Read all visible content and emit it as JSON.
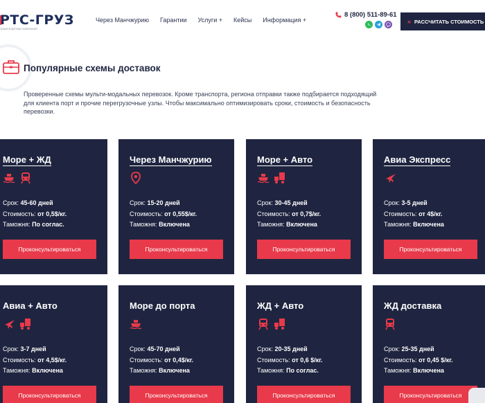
{
  "header": {
    "logo": {
      "brand": "РТС-ГРУЗ",
      "tagline": "транспортная компания"
    },
    "nav": [
      {
        "label": "Через Манчжурию"
      },
      {
        "label": "Гарантии"
      },
      {
        "label": "Услуги +"
      },
      {
        "label": "Кейсы"
      },
      {
        "label": "Информация +"
      }
    ],
    "phone": "8 (800) 511-89-61",
    "messengers": [
      "whatsapp-icon",
      "telegram-icon",
      "viber-icon"
    ],
    "cta_label": "РАССЧИТАТЬ СТОИМОСТЬ",
    "cta_arrow": "»"
  },
  "section": {
    "title": "Популярные схемы доставок",
    "description": "Проверенные схемы мульти-модальных перевозок. Кроме транспорта, региона отправки также подбирается подходящий для клиента порт и прочие перегрузочные узлы. Чтобы максимально оптимизировать сроки, стоимость и безопасность перевозки."
  },
  "labels": {
    "term": "Срок:",
    "cost": "Стоимость:",
    "customs": "Таможня:"
  },
  "cards": [
    {
      "title": "Море + ЖД",
      "icons": [
        "ship-icon",
        "train-icon"
      ],
      "term": "45-60 дней",
      "cost": "от 0,5$/кг.",
      "customs": "По соглас.",
      "button": "Проконсультироваться"
    },
    {
      "title": "Через Манчжурию",
      "icons": [
        "location-pin-icon"
      ],
      "term": "15-20 дней",
      "cost": "от 0,55$/кг.",
      "customs": "Включена",
      "button": "Проконсультироваться"
    },
    {
      "title": "Море + Авто",
      "icons": [
        "ship-icon",
        "truck-icon"
      ],
      "term": "30-45 дней",
      "cost": "от 0,7$/кг.",
      "customs": "Включена",
      "button": "Проконсультироваться"
    },
    {
      "title": "Авиа Экспресс",
      "icons": [
        "plane-icon"
      ],
      "term": "3-5 дней",
      "cost": "от 4$/кг.",
      "customs": "Включена",
      "button": "Проконсультироваться"
    },
    {
      "title": "Авиа + Авто",
      "icons": [
        "plane-icon",
        "truck-icon"
      ],
      "term": "3-7 дней",
      "cost": "от 4,5$/кг.",
      "customs": "Включена",
      "button": "Проконсультироваться"
    },
    {
      "title": "Море до порта",
      "icons": [
        "ship-icon"
      ],
      "term": "45-70 дней",
      "cost": "от 0,4$/кг.",
      "customs": "Включена",
      "button": "Проконсультироваться"
    },
    {
      "title": "ЖД + Авто",
      "icons": [
        "train-icon",
        "truck-icon"
      ],
      "term": "20-35 дней",
      "cost": "от 0,6 $/кг.",
      "customs": "По соглас.",
      "button": "Проконсультироваться"
    },
    {
      "title": "ЖД доставка",
      "icons": [
        "train-icon"
      ],
      "term": "25-35 дней",
      "cost": "от 0,45 $/кг.",
      "customs": "Включена",
      "button": "Проконсультироваться"
    }
  ],
  "colors": {
    "accent": "#e83a4a",
    "card_bg": "#1f2540",
    "brand": "#1d2d5c"
  }
}
